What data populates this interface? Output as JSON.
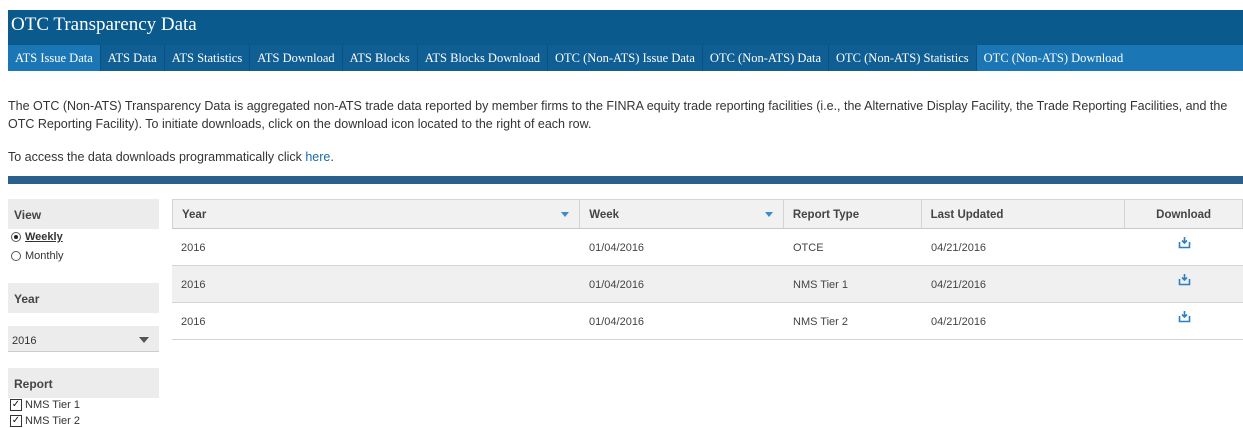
{
  "header": {
    "title": "OTC Transparency Data",
    "tabs": [
      {
        "label": "ATS Issue Data"
      },
      {
        "label": "ATS Data"
      },
      {
        "label": "ATS Statistics"
      },
      {
        "label": "ATS Download"
      },
      {
        "label": "ATS Blocks"
      },
      {
        "label": "ATS Blocks Download"
      },
      {
        "label": "OTC (Non-ATS) Issue Data"
      },
      {
        "label": "OTC (Non-ATS) Data"
      },
      {
        "label": "OTC (Non-ATS) Statistics"
      },
      {
        "label": "OTC (Non-ATS) Download"
      }
    ]
  },
  "description": "The OTC (Non-ATS) Transparency Data is aggregated non-ATS trade data reported by member firms to the FINRA equity trade reporting facilities (i.e., the Alternative Display Facility, the Trade Reporting Facilities, and the OTC Reporting Facility). To initiate downloads, click on the download icon located to the right of each row.",
  "access": {
    "prefix": "To access the data downloads programmatically click ",
    "link": "here",
    "suffix": "."
  },
  "sidebar": {
    "view": {
      "title": "View",
      "options": [
        {
          "label": "Weekly",
          "selected": true
        },
        {
          "label": "Monthly",
          "selected": false
        }
      ]
    },
    "year": {
      "title": "Year",
      "selected": "2016"
    },
    "report": {
      "title": "Report",
      "options": [
        {
          "label": "NMS Tier 1",
          "checked": true
        },
        {
          "label": "NMS Tier 2",
          "checked": true
        }
      ]
    }
  },
  "table": {
    "columns": [
      "Year",
      "Week",
      "Report Type",
      "Last Updated",
      "Download"
    ],
    "rows": [
      {
        "year": "2016",
        "week": "01/04/2016",
        "report_type": "OTCE",
        "last_updated": "04/21/2016"
      },
      {
        "year": "2016",
        "week": "01/04/2016",
        "report_type": "NMS Tier 1",
        "last_updated": "04/21/2016"
      },
      {
        "year": "2016",
        "week": "01/04/2016",
        "report_type": "NMS Tier 2",
        "last_updated": "04/21/2016"
      }
    ]
  },
  "icons": {
    "download": "download-icon",
    "select_arrow": "chevron-down-icon",
    "sort": "sort-arrow-icon"
  },
  "colors": {
    "header_bg": "#0a5a8e",
    "tab_active": "#1a76b5",
    "bluebar": "#2b5f8c",
    "link": "#1a6aaa",
    "icon": "#2a7fc6"
  }
}
